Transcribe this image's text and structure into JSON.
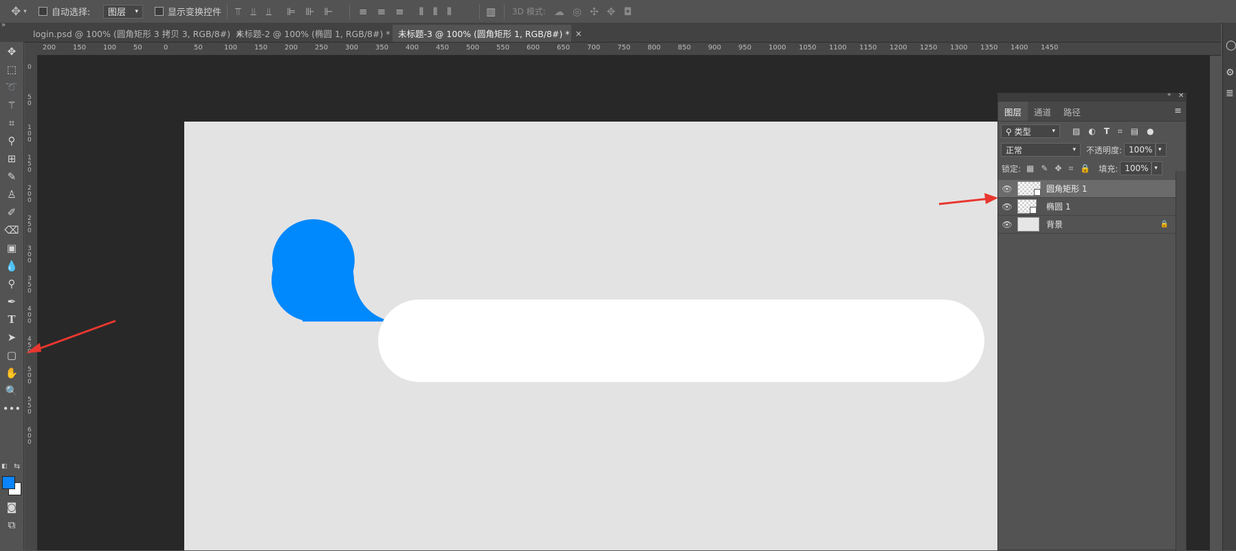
{
  "options_bar": {
    "auto_select_label": "自动选择:",
    "auto_select_value": "图层",
    "show_transform_label": "显示变换控件",
    "mode_3d_label": "3D 模式:"
  },
  "tabs": [
    {
      "label": "login.psd @ 100% (圆角矩形 3 拷贝 3, RGB/8#)",
      "close": "×"
    },
    {
      "label": "未标题-2 @ 100% (椭圆 1, RGB/8#) *",
      "close": "×"
    },
    {
      "label": "未标题-3 @ 100% (圆角矩形 1, RGB/8#) *",
      "close": "×"
    }
  ],
  "ruler_top_labels": [
    "200",
    "150",
    "100",
    "50",
    "0",
    "50",
    "100",
    "150",
    "200",
    "250",
    "300",
    "350",
    "400",
    "450",
    "500",
    "550",
    "600",
    "650",
    "700",
    "750",
    "800",
    "850",
    "900",
    "950",
    "1000",
    "1050",
    "1100",
    "1150",
    "1200",
    "1250",
    "1300",
    "1350",
    "1400",
    "1450"
  ],
  "ruler_left_labels": [
    "0",
    "50",
    "100",
    "150",
    "200",
    "250",
    "300",
    "350",
    "400",
    "450",
    "500",
    "550",
    "600"
  ],
  "colors": {
    "foreground": "#0a84ff",
    "background": "#ffffff",
    "bubble": "#0088fd",
    "field": "#ffffff",
    "canvas": "#e3e3e3",
    "arrow": "#e8372f"
  },
  "layers_panel": {
    "tabs": [
      "图层",
      "通道",
      "路径"
    ],
    "filter_label": "类型",
    "blend_mode": "正常",
    "opacity_label": "不透明度:",
    "opacity_value": "100%",
    "lock_label": "锁定:",
    "fill_label": "填充:",
    "fill_value": "100%",
    "layers": [
      {
        "name": "圆角矩形 1",
        "selected": true,
        "thumb": "shape"
      },
      {
        "name": "椭圆 1",
        "selected": false,
        "thumb": "shape"
      },
      {
        "name": "背景",
        "selected": false,
        "thumb": "background",
        "locked": true
      }
    ]
  }
}
